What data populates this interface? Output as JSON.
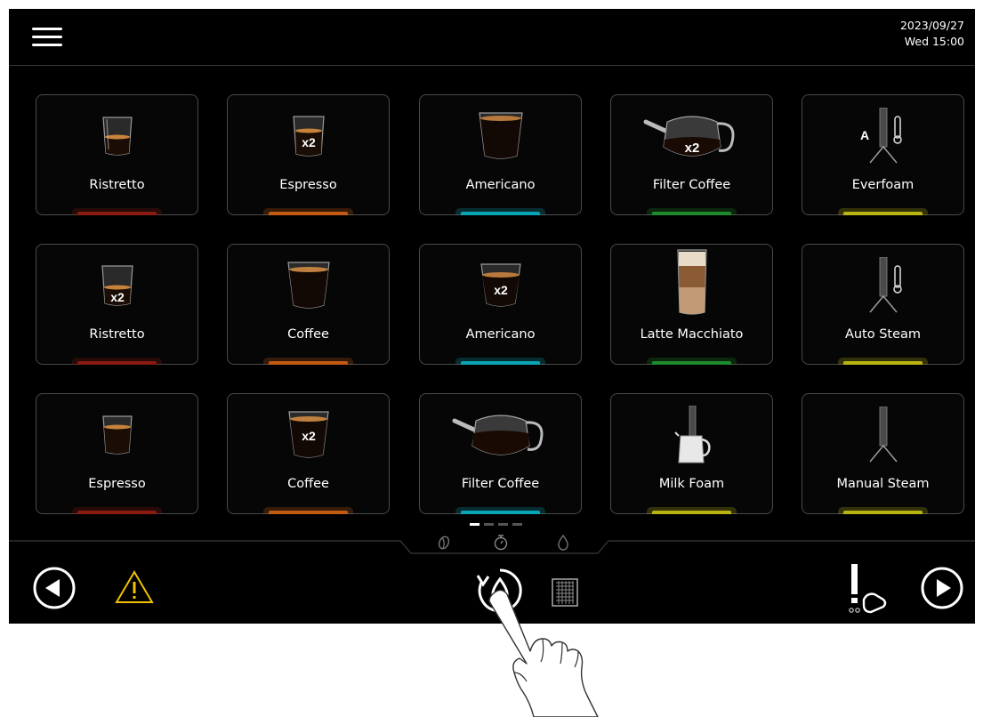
{
  "header": {
    "date": "2023/09/27",
    "day_time": "Wed  15:00"
  },
  "colors": {
    "red": "#8b1a10",
    "orange": "#c25a12",
    "teal": "#0aa5b4",
    "green": "#1f8a2c",
    "yellow": "#b8b412"
  },
  "tiles": [
    {
      "label": "Ristretto",
      "icon": "ristretto-glass-icon",
      "accent": "red"
    },
    {
      "label": "Espresso",
      "icon": "espresso-double-glass-icon",
      "badge": "x2",
      "accent": "orange"
    },
    {
      "label": "Americano",
      "icon": "americano-glass-icon",
      "accent": "teal"
    },
    {
      "label": "Filter Coffee",
      "icon": "filter-coffee-pot-double-icon",
      "badge": "x2",
      "accent": "green"
    },
    {
      "label": "Everfoam",
      "icon": "everfoam-steam-wand-icon",
      "badge": "A",
      "accent": "yellow"
    },
    {
      "label": "Ristretto",
      "icon": "ristretto-double-glass-icon",
      "badge": "x2",
      "accent": "red"
    },
    {
      "label": "Coffee",
      "icon": "coffee-glass-icon",
      "accent": "orange"
    },
    {
      "label": "Americano",
      "icon": "americano-double-glass-icon",
      "badge": "x2",
      "accent": "teal"
    },
    {
      "label": "Latte Macchiato",
      "icon": "latte-macchiato-glass-icon",
      "accent": "green"
    },
    {
      "label": "Auto Steam",
      "icon": "auto-steam-wand-icon",
      "accent": "yellow"
    },
    {
      "label": "Espresso",
      "icon": "espresso-glass-icon",
      "accent": "red"
    },
    {
      "label": "Coffee",
      "icon": "coffee-double-glass-icon",
      "badge": "x2",
      "accent": "orange"
    },
    {
      "label": "Filter Coffee",
      "icon": "filter-coffee-pot-icon",
      "accent": "teal"
    },
    {
      "label": "Milk Foam",
      "icon": "milk-foam-pitcher-icon",
      "accent": "yellow"
    },
    {
      "label": "Manual Steam",
      "icon": "manual-steam-wand-icon",
      "accent": "yellow"
    }
  ],
  "pager": {
    "pages": 4,
    "current": 1
  },
  "mode_icons": [
    "coffee-bean-icon",
    "timer-icon",
    "water-drop-icon"
  ],
  "bottombar": {
    "left": [
      "prev-arrow-icon",
      "warning-icon"
    ],
    "center": [
      "rinse-icon",
      "grid-menu-icon"
    ],
    "right": [
      "cleaning-icon",
      "next-arrow-icon"
    ]
  }
}
